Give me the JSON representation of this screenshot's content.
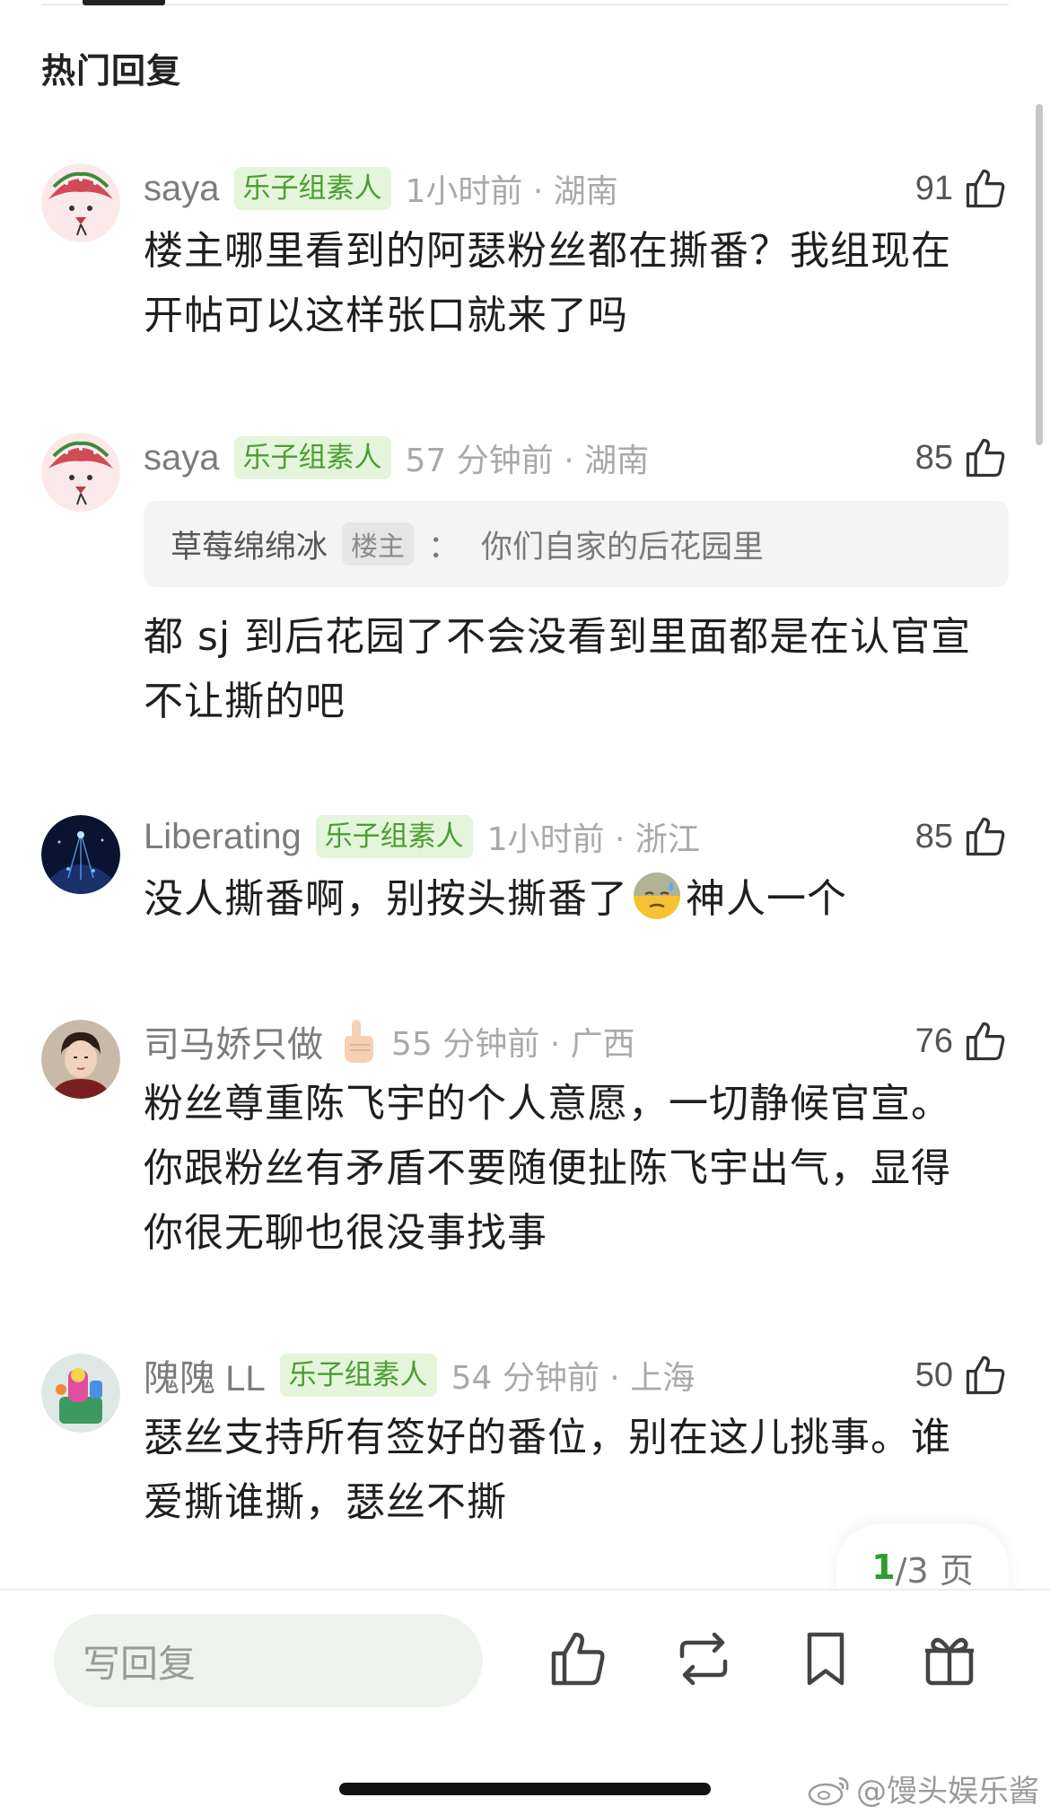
{
  "section": {
    "title": "热门回复"
  },
  "comments": [
    {
      "username": "saya",
      "badge": "乐子组素人",
      "time": "1小时前 · 湖南",
      "likes": "91",
      "text": "楼主哪里看到的阿瑟粉丝都在撕番？我组现在开帖可以这样张口就来了吗",
      "avatar": "strawberry-avatar"
    },
    {
      "username": "saya",
      "badge": "乐子组素人",
      "time": "57 分钟前 · 湖南",
      "likes": "85",
      "quote": {
        "author": "草莓绵绵冰",
        "author_badge": "楼主",
        "separator": "：",
        "text": "你们自家的后花园里"
      },
      "text": "都 sj 到后花园了不会没看到里面都是在认官宣不让撕的吧",
      "avatar": "strawberry-avatar"
    },
    {
      "username": "Liberating",
      "badge": "乐子组素人",
      "time": "1小时前 · 浙江",
      "likes": "85",
      "text_before": "没人撕番啊，别按头撕番了",
      "emoji": "downcast-sweat-emoji",
      "text_after": "神人一个",
      "avatar": "concert-avatar"
    },
    {
      "username": "司马娇只做",
      "username_emoji": "pointing-up-emoji",
      "time": "55 分钟前 · 广西",
      "likes": "76",
      "text": "粉丝尊重陈飞宇的个人意愿，一切静候官宣。你跟粉丝有矛盾不要随便扯陈飞宇出气，显得你很无聊也很没事找事",
      "avatar": "portrait-avatar"
    },
    {
      "username": "隗隗 LL",
      "badge": "乐子组素人",
      "time": "54 分钟前 · 上海",
      "likes": "50",
      "text": "瑟丝支持所有签好的番位，别在这儿挑事。谁爱撕谁撕，瑟丝不撕",
      "avatar": "toy-avatar"
    }
  ],
  "pager": {
    "current": "1",
    "total": "/3 页"
  },
  "bottom_bar": {
    "reply_placeholder": "写回复",
    "icons": [
      "thumbs-up-icon",
      "repost-icon",
      "bookmark-icon",
      "gift-icon"
    ]
  },
  "watermark": {
    "text": "@馒头娱乐酱"
  },
  "colors": {
    "badge_green": "#4a9e2f",
    "badge_bg": "#e4f5dc",
    "pager_green": "#2f9d2f"
  }
}
